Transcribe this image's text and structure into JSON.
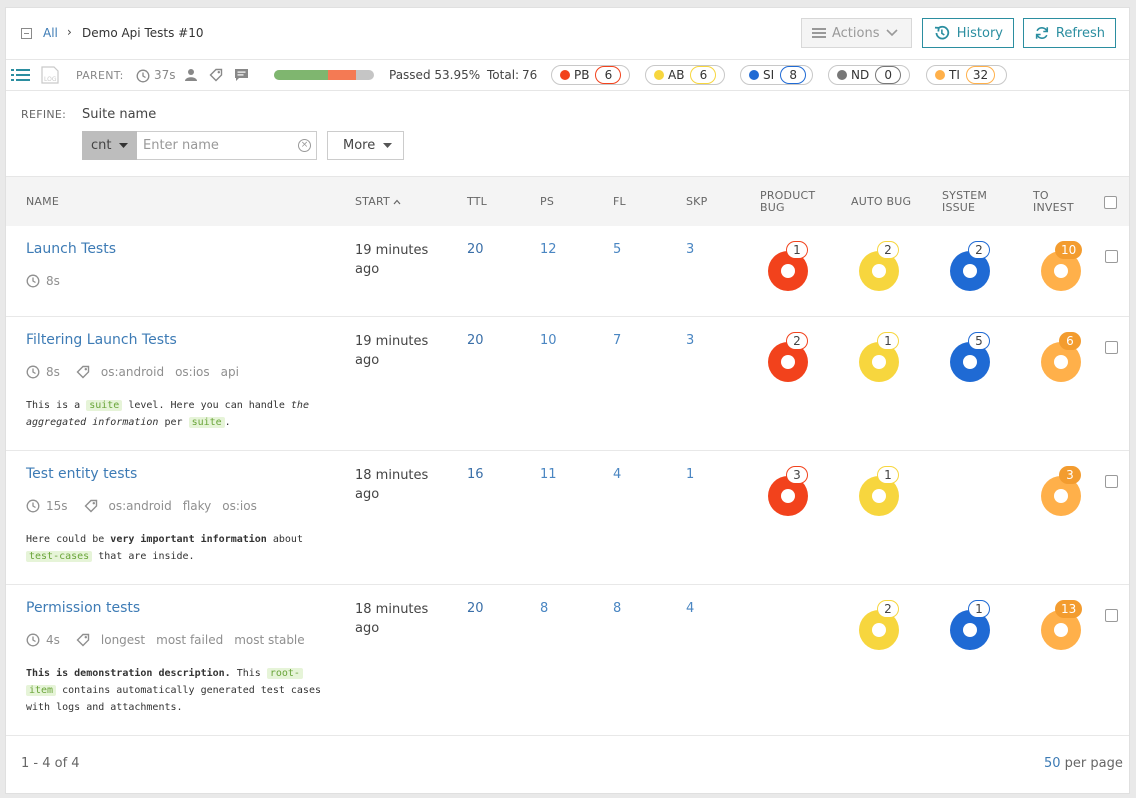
{
  "breadcrumb": {
    "all": "All",
    "current": "Demo Api Tests #10"
  },
  "buttons": {
    "actions": "Actions",
    "history": "History",
    "refresh": "Refresh"
  },
  "info": {
    "parent_label": "PARENT:",
    "duration": "37s",
    "passed_text": "Passed 53.95%",
    "total_text": "Total:",
    "total": "76",
    "progress": {
      "passed": 0.5395,
      "failed": 0.28
    }
  },
  "defect_badges": [
    {
      "code": "PB",
      "count": "6",
      "color": "#f2421c"
    },
    {
      "code": "AB",
      "count": "6",
      "color": "#f7d63e"
    },
    {
      "code": "SI",
      "count": "8",
      "color": "#1f6ad4"
    },
    {
      "code": "ND",
      "count": "0",
      "color": "#777777"
    },
    {
      "code": "TI",
      "count": "32",
      "color": "#ffb04a"
    }
  ],
  "refine": {
    "label": "REFINE:",
    "suite_name_label": "Suite name",
    "condition": "cnt",
    "input_placeholder": "Enter name",
    "more_label": "More"
  },
  "columns": {
    "name": "NAME",
    "start": "START",
    "ttl": "TTL",
    "ps": "PS",
    "fl": "FL",
    "skp": "SKP",
    "product_bug": [
      "PRODUCT",
      "BUG"
    ],
    "auto_bug": "AUTO BUG",
    "system_issue": [
      "SYSTEM",
      "ISSUE"
    ],
    "to_invest": [
      "TO",
      "INVEST"
    ]
  },
  "rows": [
    {
      "name": "Launch Tests",
      "duration": "8s",
      "tags": [],
      "start": [
        "19 minutes",
        "ago"
      ],
      "ttl": "20",
      "ps": "12",
      "fl": "5",
      "skp": "3",
      "pb": "1",
      "ab": "2",
      "si": "2",
      "ti": "10"
    },
    {
      "name": "Filtering Launch Tests",
      "duration": "8s",
      "tags": [
        "os:android",
        "os:ios",
        "api"
      ],
      "start": [
        "19 minutes",
        "ago"
      ],
      "ttl": "20",
      "ps": "10",
      "fl": "7",
      "skp": "3",
      "pb": "2",
      "ab": "1",
      "si": "5",
      "ti": "6",
      "desc": {
        "line1_a": "This is a ",
        "line1_code": "suite",
        "line1_b": " level. Here you can handle ",
        "line1_em": "the",
        "line2_em": "aggregated information",
        "line2_b": " per ",
        "line2_code": "suite",
        "line2_c": "."
      }
    },
    {
      "name": "Test entity tests",
      "duration": "15s",
      "tags": [
        "os:android",
        "flaky",
        "os:ios"
      ],
      "start": [
        "18 minutes",
        "ago"
      ],
      "ttl": "16",
      "ps": "11",
      "fl": "4",
      "skp": "1",
      "pb": "3",
      "ab": "1",
      "si": "",
      "ti": "3",
      "desc": {
        "line1_a": "Here could be ",
        "line1_strong": "very important information",
        "line1_b": " about",
        "line2_code": "test-cases",
        "line2_b": " that are inside."
      }
    },
    {
      "name": "Permission tests",
      "duration": "4s",
      "tags": [
        "longest",
        "most failed",
        "most stable"
      ],
      "start": [
        "18 minutes",
        "ago"
      ],
      "ttl": "20",
      "ps": "8",
      "fl": "8",
      "skp": "4",
      "pb": "",
      "ab": "2",
      "si": "1",
      "ti": "13",
      "desc": {
        "line1_strong": "This is demonstration description.",
        "line1_b": " This ",
        "line1_code": "root-",
        "line2_code": "item",
        "line2_b": " contains automatically generated test cases",
        "line3": "with logs and attachments."
      }
    }
  ],
  "footer": {
    "range": "1 - 4 of 4",
    "per_page_num": "50",
    "per_page_text": " per page"
  }
}
